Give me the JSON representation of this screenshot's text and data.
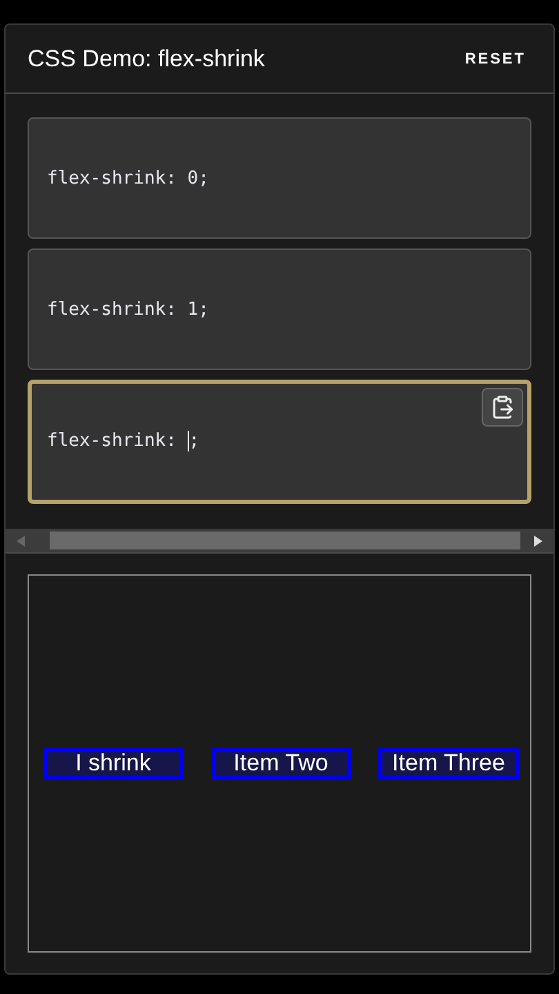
{
  "header": {
    "title": "CSS Demo: flex-shrink",
    "reset": "RESET"
  },
  "options": [
    {
      "kind": "static",
      "code": "flex-shrink: 0;",
      "selected": false
    },
    {
      "kind": "static",
      "code": "flex-shrink: 1;",
      "selected": false
    },
    {
      "kind": "editing",
      "code_before": "flex-shrink: ",
      "code_after": ";",
      "selected": true
    }
  ],
  "output": {
    "items": [
      "I shrink",
      "Item Two",
      "Item Three"
    ]
  }
}
